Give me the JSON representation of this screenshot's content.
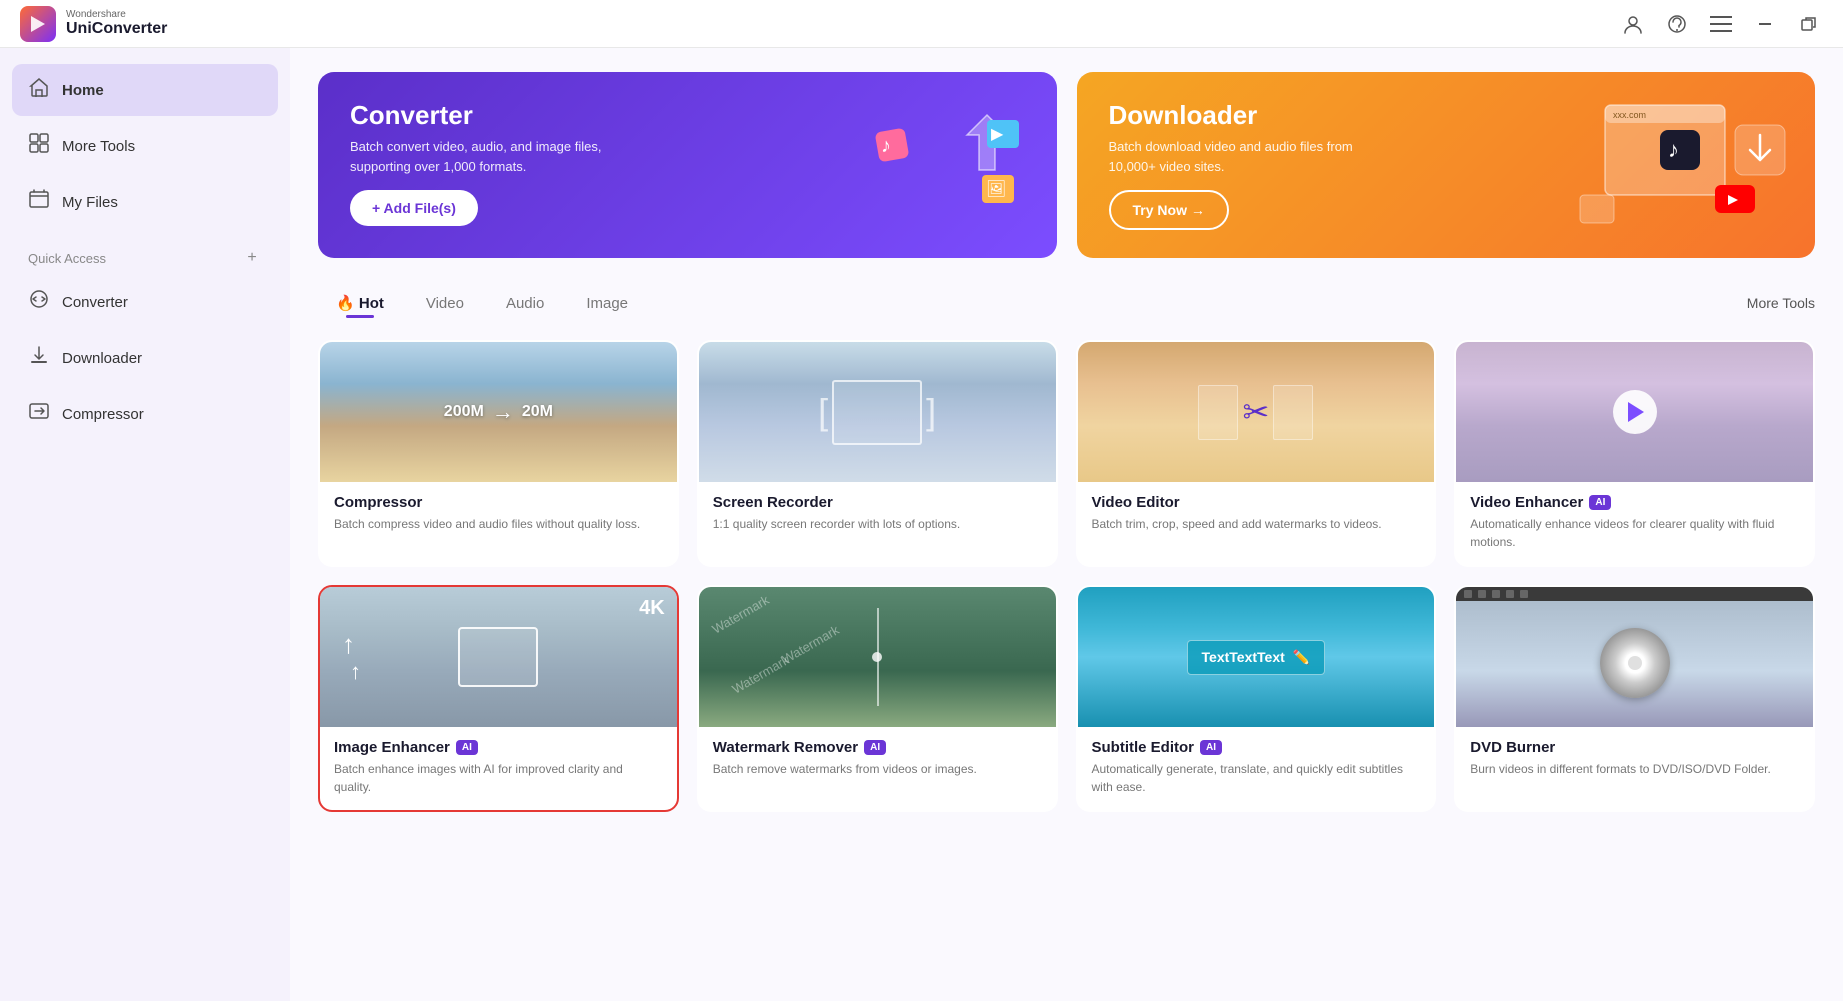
{
  "app": {
    "brand_small": "Wondershare",
    "brand_large": "UniConverter",
    "logo_symbol": "▶"
  },
  "topbar": {
    "user_icon": "👤",
    "headset_icon": "🎧",
    "menu_icon": "☰",
    "minimize_icon": "—",
    "restore_icon": "⧉"
  },
  "sidebar": {
    "home_label": "Home",
    "more_tools_label": "More Tools",
    "my_files_label": "My Files",
    "quick_access_label": "Quick Access",
    "converter_label": "Converter",
    "downloader_label": "Downloader",
    "compressor_label": "Compressor"
  },
  "hero": {
    "converter_title": "Converter",
    "converter_desc": "Batch convert video, audio, and image files, supporting over 1,000 formats.",
    "converter_btn": "+ Add File(s)",
    "downloader_title": "Downloader",
    "downloader_desc": "Batch download video and audio files from 10,000+ video sites.",
    "downloader_btn": "Try Now →"
  },
  "tabs": {
    "hot_label": "Hot",
    "hot_icon": "🔥",
    "video_label": "Video",
    "audio_label": "Audio",
    "image_label": "Image",
    "more_tools": "More Tools"
  },
  "tools": [
    {
      "name": "compressor",
      "title": "Compressor",
      "desc": "Batch compress video and audio files without quality loss.",
      "thumb_from": "200M",
      "thumb_to": "20M",
      "selected": false
    },
    {
      "name": "screen-recorder",
      "title": "Screen Recorder",
      "desc": "1:1 quality screen recorder with lots of options.",
      "selected": false
    },
    {
      "name": "video-editor",
      "title": "Video Editor",
      "desc": "Batch trim, crop, speed and add watermarks to videos.",
      "selected": false
    },
    {
      "name": "video-enhancer",
      "title": "Video Enhancer",
      "ai": true,
      "desc": "Automatically enhance videos for clearer quality with fluid motions.",
      "selected": false
    },
    {
      "name": "image-enhancer",
      "title": "Image Enhancer",
      "ai": true,
      "desc": "Batch enhance images with AI for improved clarity and quality.",
      "selected": true
    },
    {
      "name": "watermark-remover",
      "title": "Watermark Remover",
      "ai": true,
      "desc": "Batch remove watermarks from videos or images.",
      "selected": false
    },
    {
      "name": "subtitle-editor",
      "title": "Subtitle Editor",
      "ai": true,
      "desc": "Automatically generate, translate, and quickly edit subtitles with ease.",
      "selected": false
    },
    {
      "name": "dvd-burner",
      "title": "DVD Burner",
      "desc": "Burn videos in different formats to DVD/ISO/DVD Folder.",
      "selected": false
    }
  ]
}
